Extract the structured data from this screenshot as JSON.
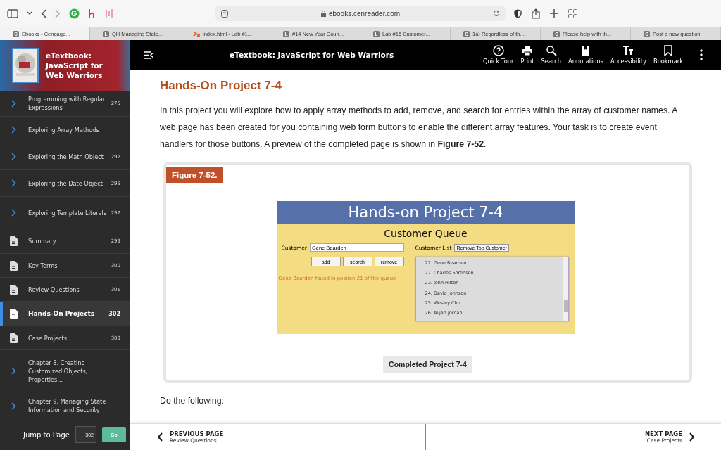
{
  "browser": {
    "url": "ebooks.cenreader.com",
    "tabs": [
      {
        "icon": "C",
        "title": "Ebooks - Cengage...",
        "selected": true
      },
      {
        "icon": "L",
        "title": "QH Managing State...",
        "selected": false
      },
      {
        "title": "index.html - Lab #1...",
        "selected": false
      },
      {
        "icon": "L",
        "title": "#14 New Year Coun...",
        "selected": false
      },
      {
        "icon": "L",
        "title": "Lab #15 Customer...",
        "selected": false
      },
      {
        "icon": "C",
        "title": "1a) Regardless of th...",
        "selected": false
      },
      {
        "icon": "C",
        "title": "Please help with th...",
        "selected": false
      },
      {
        "icon": "C",
        "title": "Post a new question",
        "selected": false
      }
    ]
  },
  "sidebar": {
    "title": "eTextbook: JavaScript for Web Warriors",
    "items": [
      {
        "kind": "chevron",
        "label": "Programming with Regular Expressions",
        "page": "275",
        "selected": false
      },
      {
        "kind": "chevron",
        "label": "Exploring Array Methods",
        "selected": false
      },
      {
        "kind": "chevron",
        "label": "Exploring the Math Object",
        "page": "292",
        "selected": false
      },
      {
        "kind": "chevron",
        "label": "Exploring the Date Object",
        "page": "295",
        "selected": false
      },
      {
        "kind": "chevron",
        "label": "Exploring Template Literals",
        "page": "297",
        "selected": false
      },
      {
        "kind": "doc",
        "label": "Summary",
        "page": "299",
        "selected": false
      },
      {
        "kind": "doc",
        "label": "Key Terms",
        "page": "300",
        "selected": false
      },
      {
        "kind": "doc",
        "label": "Review Questions",
        "page": "301",
        "selected": false
      },
      {
        "kind": "doc",
        "label": "Hands-On Projects",
        "page": "302",
        "selected": true
      },
      {
        "kind": "doc",
        "label": "Case Projects",
        "page": "309",
        "selected": false
      },
      {
        "kind": "chevron",
        "label": "Chapter 8. Creating Customized Objects, Properties...",
        "selected": false
      },
      {
        "kind": "chevron",
        "label": "Chapter 9. Managing State Information and Security",
        "selected": false
      }
    ],
    "jump": {
      "label": "Jump to Page",
      "value": "302",
      "button": "Go"
    }
  },
  "toolbar": {
    "title": "eTextbook: JavaScript for Web Warriors",
    "buttons": [
      {
        "kind": "help",
        "label": "Quick Tour"
      },
      {
        "kind": "print",
        "label": "Print"
      },
      {
        "kind": "search",
        "label": "Search"
      },
      {
        "kind": "annotations",
        "label": "Annotations"
      },
      {
        "kind": "accessibility",
        "label": "Accessibility"
      },
      {
        "kind": "bookmark",
        "label": "Bookmark"
      }
    ]
  },
  "content": {
    "heading": "Hands-On Project 7-4",
    "paragraph": "In this project you will explore how to apply array methods to add, remove, and search for entries within the array of customer names. A web page has been created for you containing web form buttons to enable the different array features. Your task is to create event handlers for those buttons. A preview of the completed page is shown in **Figure 7-52**.",
    "figure": {
      "label": "Figure 7-52.",
      "caption": "Completed Project 7-4",
      "app": {
        "title": "Hands-on Project 7-4",
        "subtitle": "Customer Queue",
        "customer_label": "Customer",
        "customer_value": "Gene Bearden",
        "buttons": [
          "add",
          "search",
          "remove"
        ],
        "message": "Gene Bearden found in postion 21 of the queue",
        "list_label": "Customer List",
        "list_button": "Remove Top Customer",
        "list": [
          "21. Gene Bearden",
          "22. Charles Sorensen",
          "23. John Hilton",
          "24. David Johnson",
          "25. Wesley Cho",
          "26. Alijah Jordan"
        ]
      }
    },
    "after": "Do the following:"
  },
  "footer": {
    "prev_label": "PREVIOUS PAGE",
    "prev_title": "Review Questions",
    "next_label": "NEXT PAGE",
    "next_title": "Case Projects"
  }
}
